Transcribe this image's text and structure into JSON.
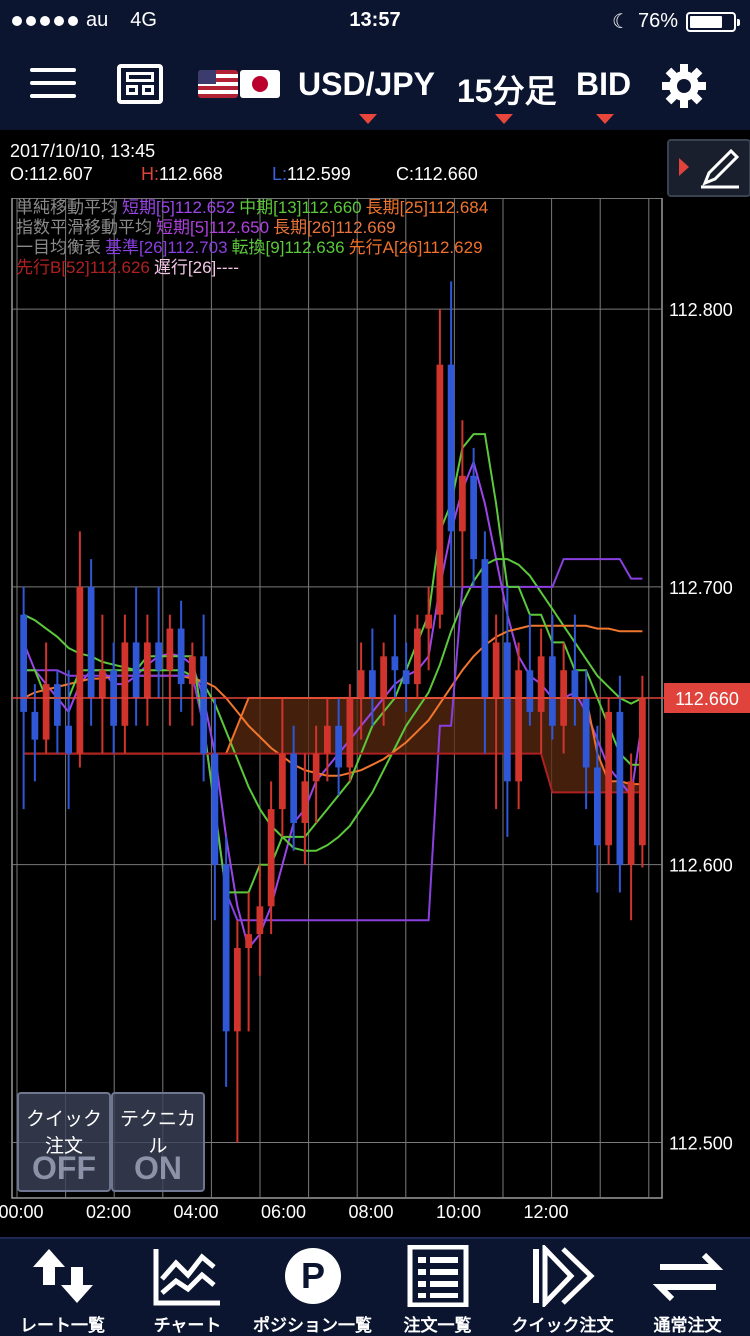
{
  "status_bar": {
    "carrier": "au",
    "network": "4G",
    "time": "13:57",
    "battery": "76%",
    "battery_level": 0.76
  },
  "header": {
    "pair": "USD/JPY",
    "timeframe": "15分足",
    "price_type": "BID"
  },
  "info": {
    "datetime": "2017/10/10, 13:45",
    "open_label": "O:",
    "open": "112.607",
    "high_label": "H:",
    "high": "112.668",
    "low_label": "L:",
    "low": "112.599",
    "close_label": "C:",
    "close": "112.660"
  },
  "legend": {
    "sma": {
      "title": "単純移動平均",
      "short": "短期[5]112.652",
      "mid": "中期[13]112.660",
      "long": "長期[25]112.684"
    },
    "ema": {
      "title": "指数平滑移動平均",
      "short": "短期[5]112.650",
      "long": "長期[26]112.669"
    },
    "ichimoku": {
      "title": "一目均衡表",
      "kijun": "基準[26]112.703",
      "tenkan": "転換[9]112.636",
      "senkou_a": "先行A[26]112.629",
      "senkou_b": "先行B[52]112.626",
      "chikou": "遅行[26]----"
    }
  },
  "colors": {
    "bull": "#d0342c",
    "bear": "#2f57d6",
    "sma_short": "#9b45e8",
    "sma_mid": "#5cc83b",
    "sma_long": "#f0762d",
    "ema_short": "#b040e0",
    "ema_long": "#e8743a",
    "kijun": "#8a3fe0",
    "tenkan": "#5cc83b",
    "senkou_a": "#f07028",
    "senkou_b": "#b02020",
    "chikou": "#f5a3d8",
    "current_price": "#e0433c"
  },
  "quick_buttons": [
    {
      "label": "クイック注文",
      "state": "OFF"
    },
    {
      "label": "テクニカル",
      "state": "ON"
    }
  ],
  "tabs": [
    {
      "label": "レート一覧",
      "icon": "rate-list-icon"
    },
    {
      "label": "チャート",
      "icon": "chart-icon"
    },
    {
      "label": "ポジション一覧",
      "icon": "position-icon"
    },
    {
      "label": "注文一覧",
      "icon": "order-list-icon"
    },
    {
      "label": "クイック注文",
      "icon": "quick-order-icon"
    },
    {
      "label": "通常注文",
      "icon": "normal-order-icon"
    }
  ],
  "chart_data": {
    "type": "candlestick",
    "price_ticks": [
      "112.800",
      "112.700",
      "112.600",
      "112.500"
    ],
    "current_price_label": "112.660",
    "ylim": [
      112.48,
      112.84
    ],
    "time_ticks": [
      "00:00",
      "02:00",
      "04:00",
      "06:00",
      "08:00",
      "10:00",
      "12:00"
    ],
    "candles": [
      {
        "time": "00:00",
        "open": 112.69,
        "high": 112.7,
        "low": 112.62,
        "close": 112.655
      },
      {
        "time": "00:15",
        "open": 112.655,
        "high": 112.665,
        "low": 112.63,
        "close": 112.645
      },
      {
        "time": "00:30",
        "open": 112.645,
        "high": 112.68,
        "low": 112.64,
        "close": 112.665
      },
      {
        "time": "00:45",
        "open": 112.665,
        "high": 112.67,
        "low": 112.64,
        "close": 112.65
      },
      {
        "time": "01:00",
        "open": 112.65,
        "high": 112.67,
        "low": 112.62,
        "close": 112.64
      },
      {
        "time": "01:15",
        "open": 112.64,
        "high": 112.72,
        "low": 112.635,
        "close": 112.7
      },
      {
        "time": "01:30",
        "open": 112.7,
        "high": 112.71,
        "low": 112.65,
        "close": 112.66
      },
      {
        "time": "01:45",
        "open": 112.66,
        "high": 112.69,
        "low": 112.64,
        "close": 112.67
      },
      {
        "time": "02:00",
        "open": 112.67,
        "high": 112.68,
        "low": 112.64,
        "close": 112.65
      },
      {
        "time": "02:15",
        "open": 112.65,
        "high": 112.69,
        "low": 112.64,
        "close": 112.68
      },
      {
        "time": "02:30",
        "open": 112.68,
        "high": 112.7,
        "low": 112.65,
        "close": 112.66
      },
      {
        "time": "02:45",
        "open": 112.66,
        "high": 112.69,
        "low": 112.65,
        "close": 112.68
      },
      {
        "time": "03:00",
        "open": 112.68,
        "high": 112.7,
        "low": 112.66,
        "close": 112.67
      },
      {
        "time": "03:15",
        "open": 112.67,
        "high": 112.69,
        "low": 112.65,
        "close": 112.685
      },
      {
        "time": "03:30",
        "open": 112.685,
        "high": 112.695,
        "low": 112.655,
        "close": 112.665
      },
      {
        "time": "03:45",
        "open": 112.665,
        "high": 112.68,
        "low": 112.65,
        "close": 112.675
      },
      {
        "time": "04:00",
        "open": 112.675,
        "high": 112.69,
        "low": 112.63,
        "close": 112.64
      },
      {
        "time": "04:15",
        "open": 112.64,
        "high": 112.66,
        "low": 112.58,
        "close": 112.6
      },
      {
        "time": "04:30",
        "open": 112.6,
        "high": 112.61,
        "low": 112.52,
        "close": 112.54
      },
      {
        "time": "04:45",
        "open": 112.54,
        "high": 112.58,
        "low": 112.5,
        "close": 112.57
      },
      {
        "time": "05:00",
        "open": 112.57,
        "high": 112.59,
        "low": 112.54,
        "close": 112.575
      },
      {
        "time": "05:15",
        "open": 112.575,
        "high": 112.6,
        "low": 112.56,
        "close": 112.585
      },
      {
        "time": "05:30",
        "open": 112.585,
        "high": 112.63,
        "low": 112.575,
        "close": 112.62
      },
      {
        "time": "05:45",
        "open": 112.62,
        "high": 112.66,
        "low": 112.61,
        "close": 112.64
      },
      {
        "time": "06:00",
        "open": 112.64,
        "high": 112.65,
        "low": 112.605,
        "close": 112.615
      },
      {
        "time": "06:15",
        "open": 112.615,
        "high": 112.64,
        "low": 112.6,
        "close": 112.63
      },
      {
        "time": "06:30",
        "open": 112.63,
        "high": 112.65,
        "low": 112.615,
        "close": 112.64
      },
      {
        "time": "06:45",
        "open": 112.64,
        "high": 112.66,
        "low": 112.63,
        "close": 112.65
      },
      {
        "time": "07:00",
        "open": 112.65,
        "high": 112.66,
        "low": 112.625,
        "close": 112.635
      },
      {
        "time": "07:15",
        "open": 112.635,
        "high": 112.665,
        "low": 112.63,
        "close": 112.66
      },
      {
        "time": "07:30",
        "open": 112.66,
        "high": 112.68,
        "low": 112.645,
        "close": 112.67
      },
      {
        "time": "07:45",
        "open": 112.67,
        "high": 112.685,
        "low": 112.65,
        "close": 112.66
      },
      {
        "time": "08:00",
        "open": 112.66,
        "high": 112.68,
        "low": 112.65,
        "close": 112.675
      },
      {
        "time": "08:15",
        "open": 112.675,
        "high": 112.69,
        "low": 112.66,
        "close": 112.67
      },
      {
        "time": "08:30",
        "open": 112.67,
        "high": 112.68,
        "low": 112.655,
        "close": 112.665
      },
      {
        "time": "08:45",
        "open": 112.665,
        "high": 112.69,
        "low": 112.66,
        "close": 112.685
      },
      {
        "time": "09:00",
        "open": 112.685,
        "high": 112.7,
        "low": 112.67,
        "close": 112.69
      },
      {
        "time": "09:15",
        "open": 112.69,
        "high": 112.8,
        "low": 112.685,
        "close": 112.78
      },
      {
        "time": "09:30",
        "open": 112.78,
        "high": 112.81,
        "low": 112.7,
        "close": 112.72
      },
      {
        "time": "09:45",
        "open": 112.72,
        "high": 112.76,
        "low": 112.7,
        "close": 112.74
      },
      {
        "time": "10:00",
        "open": 112.74,
        "high": 112.75,
        "low": 112.7,
        "close": 112.71
      },
      {
        "time": "10:15",
        "open": 112.71,
        "high": 112.72,
        "low": 112.64,
        "close": 112.66
      },
      {
        "time": "10:30",
        "open": 112.66,
        "high": 112.69,
        "low": 112.62,
        "close": 112.68
      },
      {
        "time": "10:45",
        "open": 112.68,
        "high": 112.7,
        "low": 112.61,
        "close": 112.63
      },
      {
        "time": "11:00",
        "open": 112.63,
        "high": 112.68,
        "low": 112.62,
        "close": 112.67
      },
      {
        "time": "11:15",
        "open": 112.67,
        "high": 112.69,
        "low": 112.65,
        "close": 112.655
      },
      {
        "time": "11:30",
        "open": 112.655,
        "high": 112.685,
        "low": 112.64,
        "close": 112.675
      },
      {
        "time": "11:45",
        "open": 112.675,
        "high": 112.69,
        "low": 112.645,
        "close": 112.65
      },
      {
        "time": "12:00",
        "open": 112.65,
        "high": 112.68,
        "low": 112.64,
        "close": 112.67
      },
      {
        "time": "12:15",
        "open": 112.67,
        "high": 112.69,
        "low": 112.65,
        "close": 112.66
      },
      {
        "time": "12:30",
        "open": 112.66,
        "high": 112.67,
        "low": 112.62,
        "close": 112.635
      },
      {
        "time": "12:45",
        "open": 112.635,
        "high": 112.65,
        "low": 112.59,
        "close": 112.607
      },
      {
        "time": "13:00",
        "open": 112.607,
        "high": 112.66,
        "low": 112.6,
        "close": 112.655
      },
      {
        "time": "13:15",
        "open": 112.655,
        "high": 112.668,
        "low": 112.59,
        "close": 112.6
      },
      {
        "time": "13:30",
        "open": 112.6,
        "high": 112.64,
        "low": 112.58,
        "close": 112.63
      },
      {
        "time": "13:45",
        "open": 112.607,
        "high": 112.668,
        "low": 112.599,
        "close": 112.66
      }
    ],
    "series": [
      {
        "name": "短期[5]",
        "values": [
          112.68,
          112.67,
          112.665,
          112.66,
          112.655,
          112.665,
          112.67,
          112.67,
          112.665,
          112.665,
          112.668,
          112.672,
          112.675,
          112.676,
          112.675,
          112.672,
          112.66,
          112.64,
          112.61,
          112.585,
          112.57,
          112.575,
          112.585,
          112.6,
          112.615,
          112.62,
          112.63,
          112.635,
          112.64,
          112.645,
          112.65,
          112.655,
          112.66,
          112.665,
          112.668,
          112.67,
          112.675,
          112.7,
          112.72,
          112.735,
          112.745,
          112.73,
          112.71,
          112.69,
          112.675,
          112.668,
          112.665,
          112.66,
          112.66,
          112.662,
          112.655,
          112.645,
          112.635,
          112.63,
          112.625,
          112.652
        ]
      },
      {
        "name": "中期[13]",
        "values": [
          112.69,
          112.688,
          112.685,
          112.682,
          112.678,
          112.676,
          112.675,
          112.673,
          112.672,
          112.671,
          112.67,
          112.67,
          112.67,
          112.67,
          112.67,
          112.668,
          112.665,
          112.658,
          112.648,
          112.638,
          112.628,
          112.62,
          112.614,
          112.61,
          112.606,
          112.605,
          112.605,
          112.607,
          112.61,
          112.614,
          112.62,
          112.626,
          112.634,
          112.642,
          112.65,
          112.656,
          112.662,
          112.672,
          112.684,
          112.694,
          112.702,
          112.708,
          112.71,
          112.71,
          112.708,
          112.704,
          112.698,
          112.692,
          112.686,
          112.68,
          112.674,
          112.668,
          112.664,
          112.66,
          112.658,
          112.66
        ]
      },
      {
        "name": "長期[25]",
        "values": [
          112.66,
          112.662,
          112.663,
          112.664,
          112.665,
          112.666,
          112.667,
          112.667,
          112.668,
          112.668,
          112.668,
          112.668,
          112.668,
          112.668,
          112.668,
          112.667,
          112.666,
          112.664,
          112.66,
          112.655,
          112.65,
          112.646,
          112.642,
          112.639,
          112.636,
          112.634,
          112.633,
          112.632,
          112.632,
          112.633,
          112.634,
          112.636,
          112.638,
          112.641,
          112.644,
          112.648,
          112.652,
          112.658,
          112.664,
          112.67,
          112.675,
          112.679,
          112.682,
          112.684,
          112.685,
          112.686,
          112.686,
          112.686,
          112.686,
          112.686,
          112.686,
          112.685,
          112.685,
          112.684,
          112.684,
          112.684
        ]
      },
      {
        "name": "基準[26]",
        "values": [
          112.67,
          112.67,
          112.67,
          112.67,
          112.668,
          112.668,
          112.668,
          112.668,
          112.668,
          112.668,
          112.668,
          112.668,
          112.668,
          112.668,
          112.668,
          112.668,
          112.65,
          112.62,
          112.59,
          112.58,
          112.58,
          112.58,
          112.58,
          112.58,
          112.58,
          112.58,
          112.58,
          112.58,
          112.58,
          112.58,
          112.58,
          112.58,
          112.58,
          112.58,
          112.58,
          112.58,
          112.58,
          112.65,
          112.65,
          112.7,
          112.7,
          112.7,
          112.7,
          112.7,
          112.7,
          112.7,
          112.7,
          112.7,
          112.71,
          112.71,
          112.71,
          112.71,
          112.71,
          112.71,
          112.703,
          112.703
        ]
      },
      {
        "name": "転換[9]",
        "values": [
          112.67,
          112.67,
          112.66,
          112.66,
          112.66,
          112.67,
          112.67,
          112.67,
          112.67,
          112.67,
          112.67,
          112.675,
          112.675,
          112.675,
          112.675,
          112.675,
          112.65,
          112.62,
          112.59,
          112.59,
          112.59,
          112.6,
          112.6,
          112.61,
          112.61,
          112.61,
          112.615,
          112.62,
          112.625,
          112.63,
          112.64,
          112.65,
          112.655,
          112.66,
          112.67,
          112.68,
          112.69,
          112.72,
          112.73,
          112.75,
          112.755,
          112.755,
          112.73,
          112.7,
          112.7,
          112.69,
          112.69,
          112.68,
          112.68,
          112.67,
          112.67,
          112.66,
          112.65,
          112.64,
          112.636,
          112.636
        ]
      },
      {
        "name": "先行A[26]",
        "values": [
          112.64,
          112.64,
          112.64,
          112.64,
          112.64,
          112.64,
          112.64,
          112.64,
          112.64,
          112.64,
          112.64,
          112.64,
          112.64,
          112.64,
          112.64,
          112.64,
          112.64,
          112.64,
          112.64,
          112.65,
          112.66,
          112.66,
          112.66,
          112.66,
          112.66,
          112.66,
          112.66,
          112.66,
          112.66,
          112.66,
          112.66,
          112.66,
          112.66,
          112.66,
          112.66,
          112.66,
          112.66,
          112.66,
          112.66,
          112.66,
          112.66,
          112.66,
          112.66,
          112.66,
          112.66,
          112.66,
          112.66,
          112.66,
          112.66,
          112.66,
          112.66,
          112.64,
          112.63,
          112.63,
          112.629,
          112.629
        ]
      },
      {
        "name": "先行B[52]",
        "values": [
          112.64,
          112.64,
          112.64,
          112.64,
          112.64,
          112.64,
          112.64,
          112.64,
          112.64,
          112.64,
          112.64,
          112.64,
          112.64,
          112.64,
          112.64,
          112.64,
          112.64,
          112.64,
          112.64,
          112.64,
          112.64,
          112.64,
          112.64,
          112.64,
          112.64,
          112.64,
          112.64,
          112.64,
          112.64,
          112.64,
          112.64,
          112.64,
          112.64,
          112.64,
          112.64,
          112.64,
          112.64,
          112.64,
          112.64,
          112.64,
          112.64,
          112.64,
          112.64,
          112.64,
          112.64,
          112.64,
          112.64,
          112.626,
          112.626,
          112.626,
          112.626,
          112.626,
          112.626,
          112.626,
          112.626,
          112.626
        ]
      }
    ]
  }
}
